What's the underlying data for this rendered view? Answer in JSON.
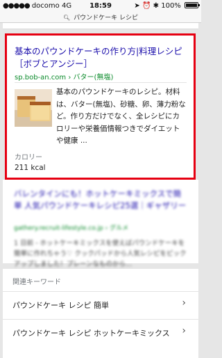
{
  "status": {
    "carrier": "docomo",
    "network": "4G",
    "time": "18:59",
    "battery": "100%"
  },
  "urlbar": {
    "text": "パウンドケーキ レシピ"
  },
  "result": {
    "title": "基本のパウンドケーキの作り方|料理レシピ［ボブとアンジー］",
    "domain": "sp.bob-an.com",
    "breadcrumb": "› バター(無塩)",
    "snippet": "基本のパウンドケーキのレシピ。材料は、バター(無塩)、砂糖、卵、薄力粉など。作り方だけでなく、全レシピにカロリーや栄養価情報つきでダイエットや健康 ...",
    "calorie_label": "カロリー",
    "calorie_value": "211 kcal"
  },
  "blurred_result": {
    "title": "バレンタインにも！ホットケーキミックスで簡単 人気パウンドケーキレシピ25選｜ギャザリー",
    "url": "gathery.recruit-lifestyle.co.jp › グルメ",
    "snippet": "1 日前 - ホットケーキミックスを使えばパウンドケーキを簡単に作れちゃう♡ クックパッドから人気レシピをピックアップしました！プレーンなものから..."
  },
  "related": {
    "heading": "関連キーワード",
    "items": [
      {
        "label": "パウンドケーキ レシピ 簡単"
      },
      {
        "label": "パウンドケーキ レシピ ホットケーキミックス"
      }
    ]
  }
}
